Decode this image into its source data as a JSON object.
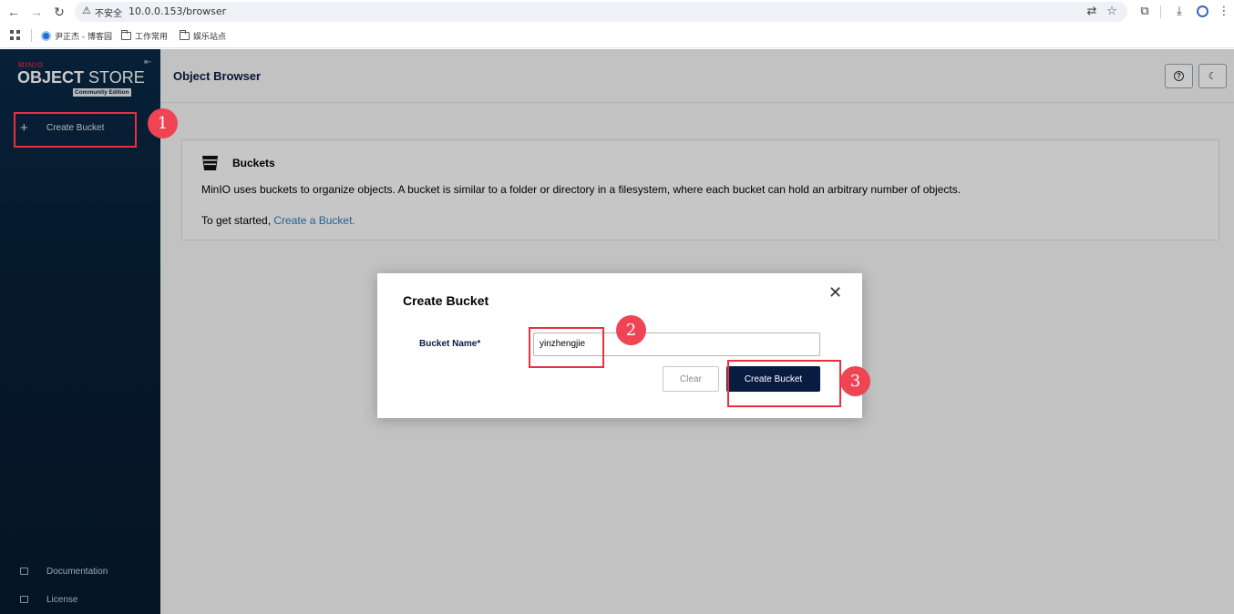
{
  "browser": {
    "url": "10.0.0.153/browser",
    "insecure_label": "不安全",
    "bookmarks": [
      "尹正杰 - 博客园",
      "工作常用",
      "娱乐站点"
    ]
  },
  "sidebar": {
    "logo_brand": "MINIO",
    "logo_object": "OBJECT",
    "logo_store": "STORE",
    "logo_edition": "Community Edition",
    "create_bucket_label": "Create Bucket",
    "documentation_label": "Documentation",
    "license_label": "License"
  },
  "header": {
    "title": "Object Browser"
  },
  "info_card": {
    "title": "Buckets",
    "description": "MinIO uses buckets to organize objects. A bucket is similar to a folder or directory in a filesystem, where each bucket can hold an arbitrary number of objects.",
    "start_prefix": "To get started, ",
    "start_link": "Create a Bucket."
  },
  "modal": {
    "title": "Create Bucket",
    "field_label": "Bucket Name*",
    "field_value": "yinzhengjie",
    "clear_label": "Clear",
    "submit_label": "Create Bucket"
  },
  "annotations": [
    "1",
    "2",
    "3"
  ],
  "colors": {
    "sidebar_bg": "#081f37",
    "primary_button": "#081c42",
    "annotation_red": "#e8303e",
    "link": "#2f7bb8"
  }
}
